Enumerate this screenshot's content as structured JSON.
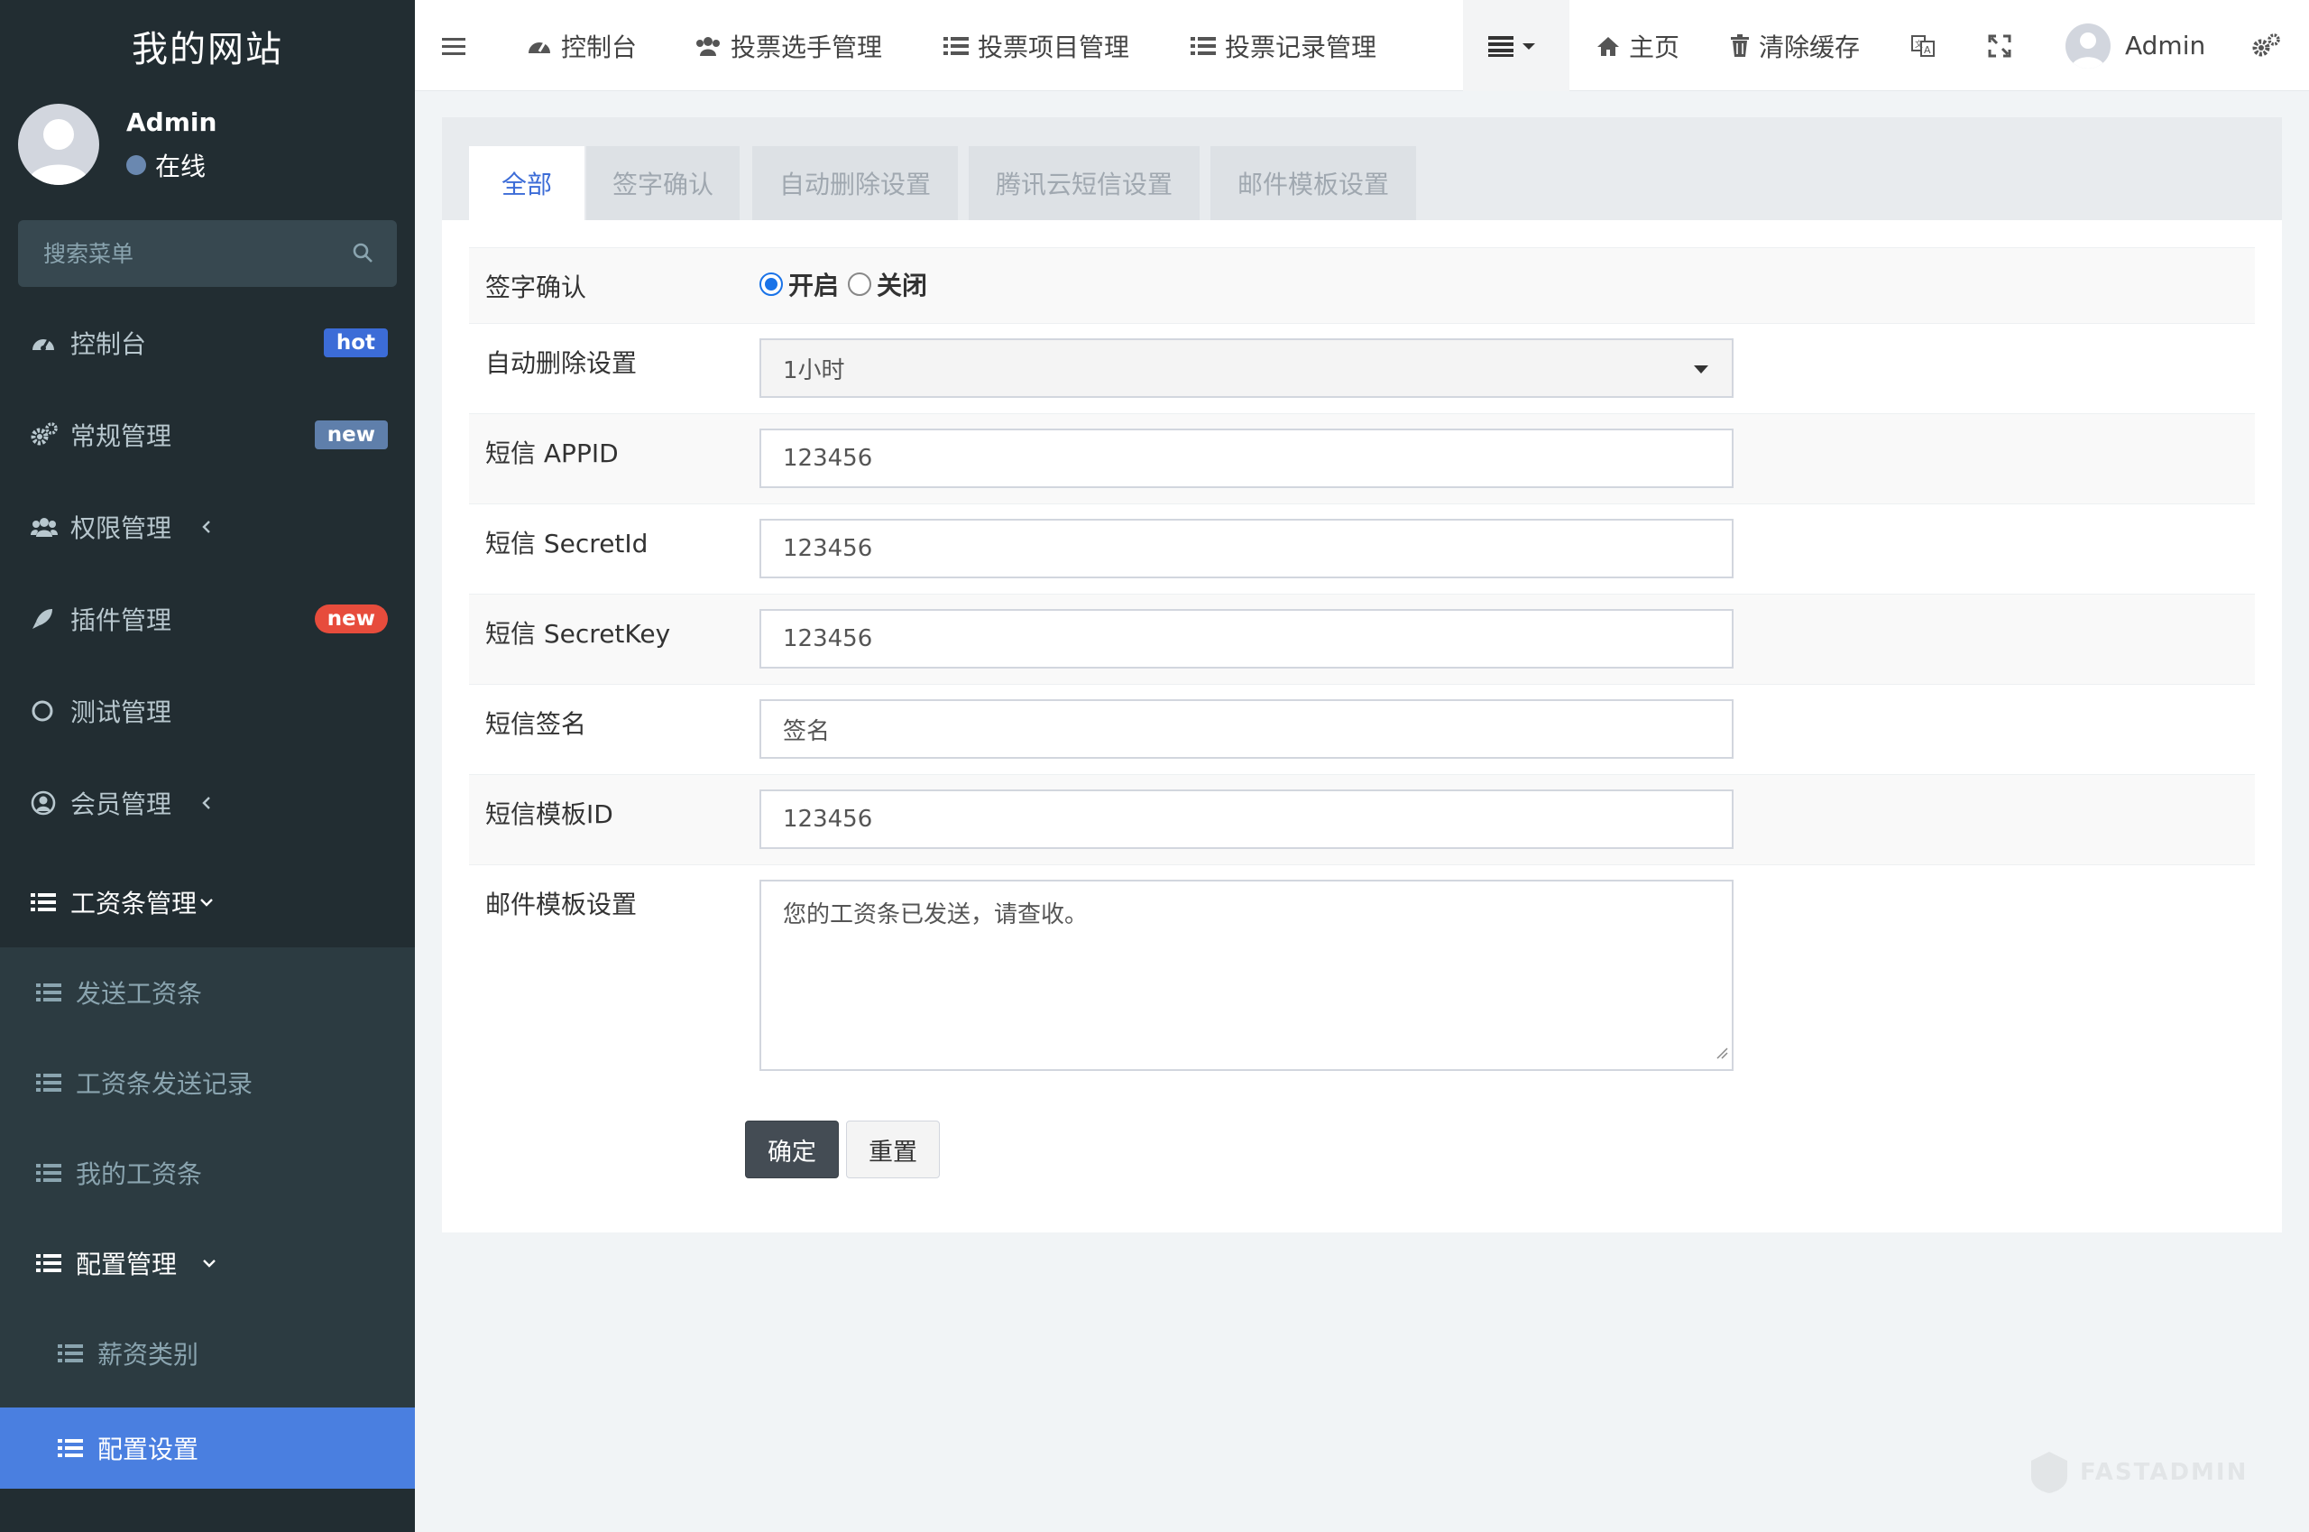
{
  "sidebar": {
    "logo": "我的网站",
    "user": {
      "name": "Admin",
      "status": "在线"
    },
    "search": {
      "placeholder": "搜索菜单"
    },
    "items": [
      {
        "label": "控制台",
        "badge": "hot",
        "badge_color": "#3c6cd7"
      },
      {
        "label": "常规管理",
        "badge": "new",
        "badge_color": "#5f7fab"
      },
      {
        "label": "权限管理"
      },
      {
        "label": "插件管理",
        "badge": "new",
        "badge_color": "#e74c3c"
      },
      {
        "label": "测试管理"
      },
      {
        "label": "会员管理"
      },
      {
        "label": "工资条管理"
      }
    ],
    "payslip_sub": [
      {
        "label": "发送工资条"
      },
      {
        "label": "工资条发送记录"
      },
      {
        "label": "我的工资条"
      }
    ],
    "config_menu": {
      "label": "配置管理"
    },
    "config_sub": [
      {
        "label": "薪资类别"
      },
      {
        "label": "配置设置"
      }
    ]
  },
  "topnav": {
    "items": [
      {
        "label": "控制台"
      },
      {
        "label": "投票选手管理"
      },
      {
        "label": "投票项目管理"
      },
      {
        "label": "投票记录管理"
      }
    ],
    "home": "主页",
    "clear_cache": "清除缓存",
    "user": "Admin"
  },
  "tabs": [
    "全部",
    "签字确认",
    "自动删除设置",
    "腾讯云短信设置",
    "邮件模板设置"
  ],
  "form": {
    "sign_confirm": {
      "label": "签字确认",
      "options": [
        "开启",
        "关闭"
      ],
      "selected": "开启"
    },
    "auto_delete": {
      "label": "自动删除设置",
      "value": "1小时"
    },
    "sms_appid": {
      "label": "短信 APPID",
      "value": "123456"
    },
    "sms_secretid": {
      "label": "短信 SecretId",
      "value": "123456"
    },
    "sms_secretkey": {
      "label": "短信 SecretKey",
      "value": "123456"
    },
    "sms_sign": {
      "label": "短信签名",
      "value": "签名"
    },
    "sms_template": {
      "label": "短信模板ID",
      "value": "123456"
    },
    "mail_template": {
      "label": "邮件模板设置",
      "value": "您的工资条已发送，请查收。"
    },
    "submit": "确定",
    "reset": "重置"
  },
  "watermark": "FASTADMIN",
  "colors": {
    "sidebar_bg": "#222d32",
    "accent": "#4a7fe0",
    "primary_btn": "#444c54"
  }
}
